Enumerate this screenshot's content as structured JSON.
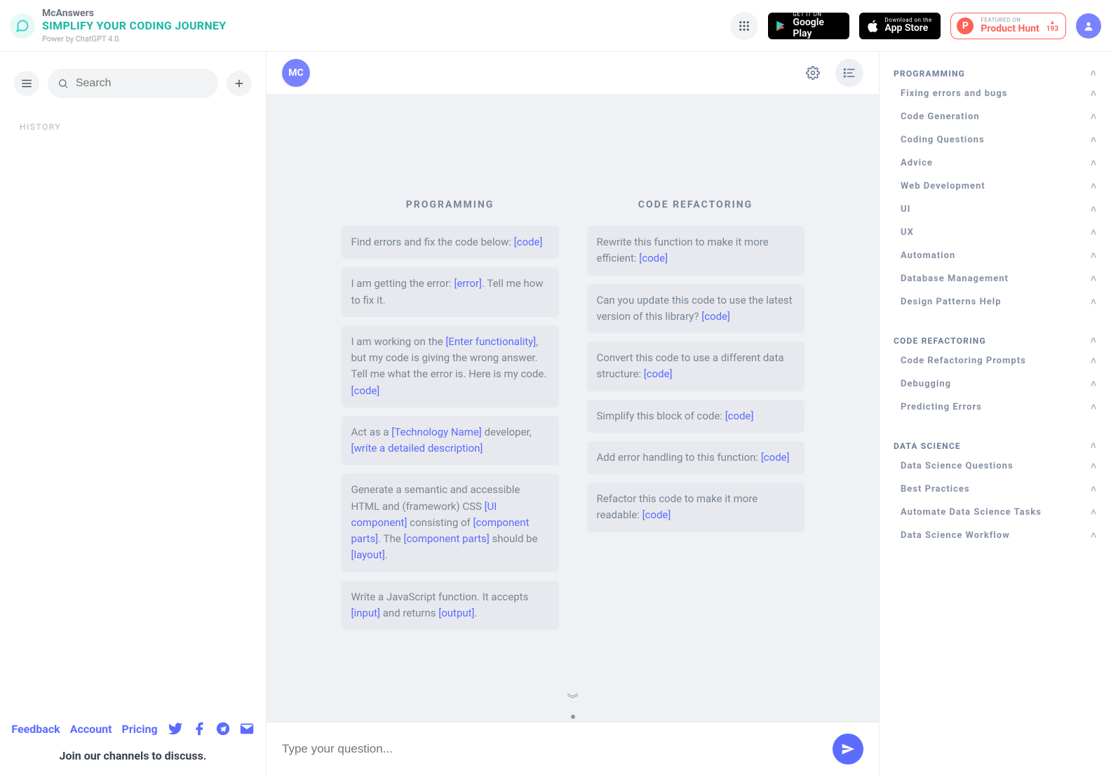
{
  "header": {
    "app_title": "McAnswers",
    "subtitle": "SIMPLIFY YOUR CODING JOURNEY",
    "powered": "Power by ChatGPT 4.0.",
    "google_small": "GET IT ON",
    "google_big": "Google Play",
    "apple_small": "Download on the",
    "apple_big": "App Store",
    "ph_small": "FEATURED ON",
    "ph_big": "Product Hunt",
    "ph_count": "193"
  },
  "left": {
    "search_placeholder": "Search",
    "history_label": "HISTORY",
    "links": {
      "feedback": "Feedback",
      "account": "Account",
      "pricing": "Pricing"
    },
    "join_text": "Join our channels to discuss."
  },
  "center": {
    "avatar": "MC",
    "columns": [
      {
        "title": "PROGRAMMING",
        "prompts": [
          {
            "parts": [
              {
                "t": "Find errors and fix the code below: "
              },
              {
                "t": "[code]",
                "k": true
              }
            ]
          },
          {
            "parts": [
              {
                "t": "I am getting the error: "
              },
              {
                "t": "[error]",
                "k": true
              },
              {
                "t": ". Tell me how to fix it."
              }
            ]
          },
          {
            "parts": [
              {
                "t": "I am working on the "
              },
              {
                "t": "[Enter functionality]",
                "k": true
              },
              {
                "t": ", but my code is giving the wrong answer. Tell me what the error is. Here is my code. "
              },
              {
                "t": "[code]",
                "k": true
              }
            ]
          },
          {
            "parts": [
              {
                "t": "Act as a "
              },
              {
                "t": "[Technology Name]",
                "k": true
              },
              {
                "t": " developer, "
              },
              {
                "t": "[write a detailed description]",
                "k": true
              }
            ]
          },
          {
            "parts": [
              {
                "t": "Generate a semantic and accessible HTML and (framework) CSS "
              },
              {
                "t": "[UI component]",
                "k": true
              },
              {
                "t": " consisting of "
              },
              {
                "t": "[component parts]",
                "k": true
              },
              {
                "t": ". The "
              },
              {
                "t": "[component parts]",
                "k": true
              },
              {
                "t": " should be "
              },
              {
                "t": "[layout]",
                "k": true
              },
              {
                "t": "."
              }
            ]
          },
          {
            "parts": [
              {
                "t": "Write a JavaScript function. It accepts "
              },
              {
                "t": "[input]",
                "k": true
              },
              {
                "t": " and returns "
              },
              {
                "t": "[output]",
                "k": true
              },
              {
                "t": "."
              }
            ]
          }
        ]
      },
      {
        "title": "CODE REFACTORING",
        "prompts": [
          {
            "parts": [
              {
                "t": "Rewrite this function to make it more efficient: "
              },
              {
                "t": "[code]",
                "k": true
              }
            ]
          },
          {
            "parts": [
              {
                "t": "Can you update this code to use the latest version of this library? "
              },
              {
                "t": "[code]",
                "k": true
              }
            ]
          },
          {
            "parts": [
              {
                "t": "Convert this code to use a different data structure: "
              },
              {
                "t": "[code]",
                "k": true
              }
            ]
          },
          {
            "parts": [
              {
                "t": "Simplify this block of code: "
              },
              {
                "t": "[code]",
                "k": true
              }
            ]
          },
          {
            "parts": [
              {
                "t": "Add error handling to this function: "
              },
              {
                "t": "[code]",
                "k": true
              }
            ]
          },
          {
            "parts": [
              {
                "t": "Refactor this code to make it more readable: "
              },
              {
                "t": "[code]",
                "k": true
              }
            ]
          }
        ]
      }
    ],
    "input_placeholder": "Type your question...",
    "scroll_glyph": "︾"
  },
  "right": {
    "sections": [
      {
        "title": "PROGRAMMING",
        "items": [
          "Fixing errors and bugs",
          "Code Generation",
          "Coding Questions",
          "Advice",
          "Web Development",
          "UI",
          "UX",
          "Automation",
          "Database Management",
          "Design Patterns Help"
        ]
      },
      {
        "title": "CODE REFACTORING",
        "items": [
          "Code Refactoring Prompts",
          "Debugging",
          "Predicting Errors"
        ]
      },
      {
        "title": "DATA SCIENCE",
        "items": [
          "Data Science Questions",
          "Best Practices",
          "Automate Data Science Tasks",
          "Data Science Workflow"
        ]
      }
    ]
  }
}
